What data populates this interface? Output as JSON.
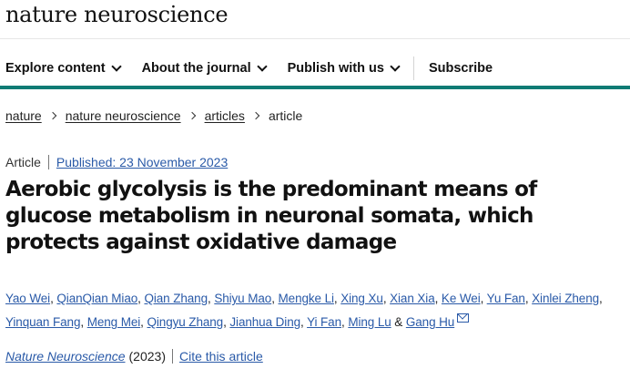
{
  "site": {
    "brand": "nature neuroscience"
  },
  "nav": {
    "items": [
      {
        "label": "Explore content"
      },
      {
        "label": "About the journal"
      },
      {
        "label": "Publish with us"
      }
    ],
    "subscribe": "Subscribe"
  },
  "breadcrumb": [
    "nature",
    "nature neuroscience",
    "articles",
    "article"
  ],
  "article": {
    "type": "Article",
    "published": "Published: 23 November 2023",
    "title": "Aerobic glycolysis is the predominant means of glucose metabolism in neuronal somata, which protects against oxidative damage",
    "authors": [
      "Yao Wei",
      "QianQian Miao",
      "Qian Zhang",
      "Shiyu Mao",
      "Mengke Li",
      "Xing Xu",
      "Xian Xia",
      "Ke Wei",
      "Yu Fan",
      "Xinlei Zheng",
      "Yinquan Fang",
      "Meng Mei",
      "Qingyu Zhang",
      "Jianhua Ding",
      "Yi Fan",
      "Ming Lu",
      "Gang Hu"
    ],
    "author_join": "&",
    "journal": "Nature Neuroscience",
    "year": "(2023)",
    "cite": "Cite this article"
  },
  "icons": {
    "mail": "mail-icon",
    "chevron": "chevron-down-icon",
    "crumb-separator": "chevron-right-icon"
  },
  "colors": {
    "accent_bar": "#0f7b74",
    "link": "#2a5aa8"
  }
}
